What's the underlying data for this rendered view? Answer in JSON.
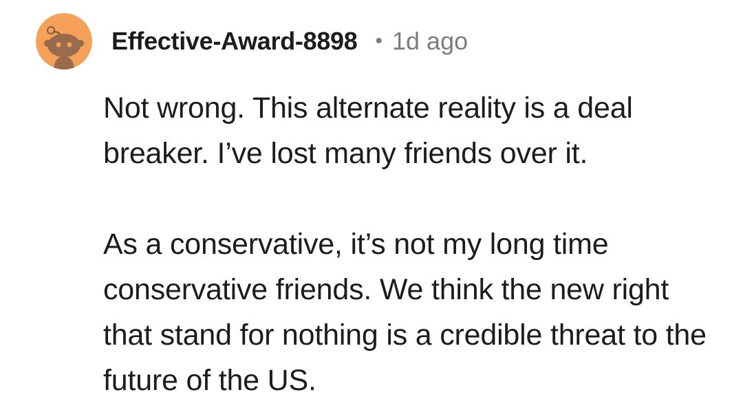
{
  "comment": {
    "author": "Effective-Award-8898",
    "separator": "•",
    "timestamp": "1d ago",
    "avatar_icon": "reddit-snoo-avatar-icon",
    "avatar_bg_color": "#f5a15a",
    "paragraphs": [
      "Not wrong. This alternate reality is a deal breaker. I’ve lost many friends over it.",
      "As a conservative, it’s not my long time conservative friends. We think the new right that stand for nothing is a credible threat to the future of the US."
    ]
  }
}
